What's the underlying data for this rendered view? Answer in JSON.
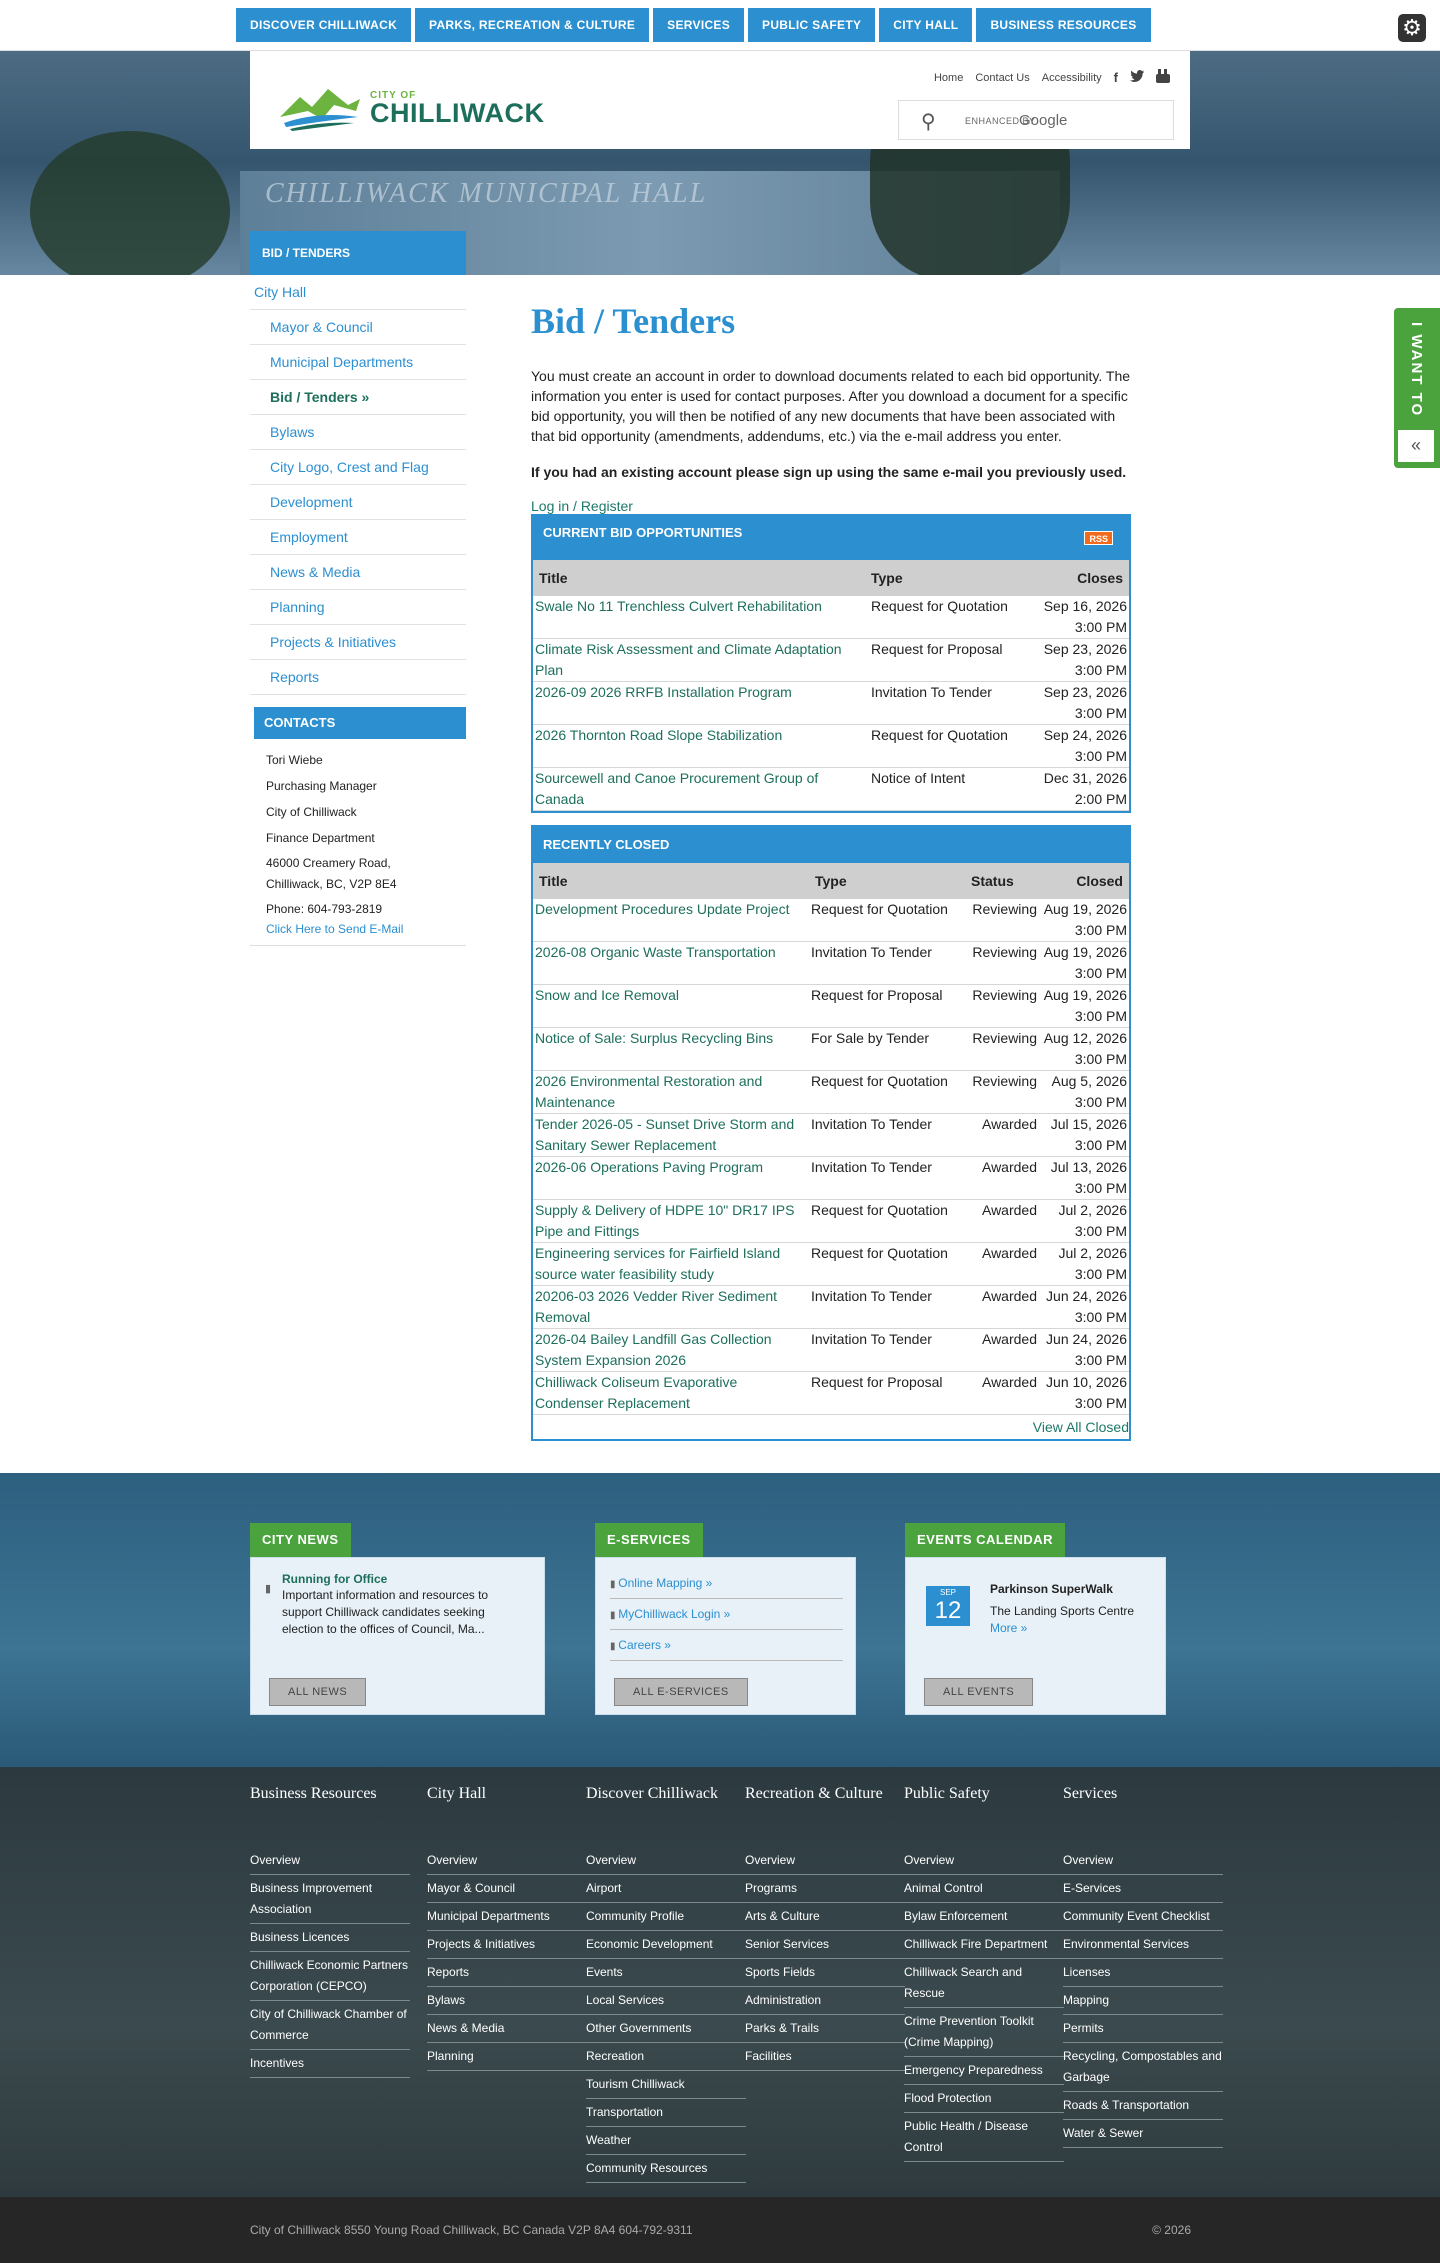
{
  "topnav": [
    "DISCOVER CHILLIWACK",
    "PARKS, RECREATION & CULTURE",
    "SERVICES",
    "PUBLIC SAFETY",
    "CITY HALL",
    "BUSINESS RESOURCES"
  ],
  "hero": {
    "building_text": "CHILLIWACK MUNICIPAL HALL"
  },
  "logo": {
    "small": "CITY OF",
    "big": "CHILLIWACK"
  },
  "utility": {
    "home": "Home",
    "contact": "Contact Us",
    "access": "Accessibility"
  },
  "search": {
    "enhanced": "ENHANCED BY",
    "brand": "Google"
  },
  "iwant": {
    "label": "I WANT TO",
    "chevron": "«"
  },
  "sidebar": {
    "header": "BID / TENDERS",
    "top": "City Hall",
    "items": [
      "Mayor & Council",
      "Municipal Departments",
      "Bid / Tenders »",
      "Bylaws",
      "City Logo, Crest and Flag",
      "Development",
      "Employment",
      "News & Media",
      "Planning",
      "Projects & Initiatives",
      "Reports"
    ]
  },
  "contacts": {
    "header": "CONTACTS",
    "name": "Tori Wiebe",
    "role": "Purchasing Manager",
    "org": "City of Chilliwack",
    "dept": "Finance Department",
    "addr1": "46000 Creamery Road,",
    "addr2": "Chilliwack, BC, V2P 8E4",
    "phone": "Phone: 604-793-2819",
    "email": "Click Here to Send E-Mail"
  },
  "content": {
    "title": "Bid / Tenders",
    "intro": "You must create an account in order to download documents related to each bid opportunity.  The information you enter is used for contact purposes.  After you download a document for a specific bid opportunity, you will then be notified of any new documents that have been associated with that bid opportunity (amendments, addendums, etc.) via the e-mail address you enter.",
    "note": "If you had an existing account please sign up using the same e-mail you previously used.",
    "login": "Log in / Register"
  },
  "current": {
    "header": "CURRENT BID OPPORTUNITIES",
    "rss": "RSS",
    "cols": {
      "title": "Title",
      "type": "Type",
      "closes": "Closes"
    },
    "rows": [
      {
        "title": "Swale No 11 Trenchless Culvert Rehabilitation",
        "type": "Request for Quotation",
        "date": "Sep 16, 2026",
        "time": "3:00 PM"
      },
      {
        "title": "Climate Risk Assessment and Climate Adaptation Plan",
        "type": "Request for Proposal",
        "date": "Sep 23, 2026",
        "time": "3:00 PM"
      },
      {
        "title": "2026-09 2026 RRFB Installation Program",
        "type": "Invitation To Tender",
        "date": "Sep 23, 2026",
        "time": "3:00 PM"
      },
      {
        "title": "2026 Thornton Road Slope Stabilization",
        "type": "Request for Quotation",
        "date": "Sep 24, 2026",
        "time": "3:00 PM"
      },
      {
        "title": "Sourcewell and Canoe Procurement Group of Canada",
        "type": "Notice of Intent",
        "date": "Dec 31, 2026",
        "time": "2:00 PM"
      }
    ]
  },
  "closed": {
    "header": "RECENTLY CLOSED",
    "cols": {
      "title": "Title",
      "type": "Type",
      "status": "Status",
      "closed": "Closed"
    },
    "view_all": "View All Closed",
    "rows": [
      {
        "title": "Development Procedures Update Project",
        "type": "Request for Quotation",
        "status": "Reviewing",
        "date": "Aug 19, 2026",
        "time": "3:00 PM"
      },
      {
        "title": "2026-08 Organic Waste Transportation",
        "type": "Invitation To Tender",
        "status": "Reviewing",
        "date": "Aug 19, 2026",
        "time": "3:00 PM"
      },
      {
        "title": "Snow and Ice Removal",
        "type": "Request for Proposal",
        "status": "Reviewing",
        "date": "Aug 19, 2026",
        "time": "3:00 PM"
      },
      {
        "title": "Notice of Sale: Surplus Recycling Bins",
        "type": "For Sale by Tender",
        "status": "Reviewing",
        "date": "Aug 12, 2026",
        "time": "3:00 PM"
      },
      {
        "title": "2026 Environmental Restoration and Maintenance",
        "type": "Request for Quotation",
        "status": "Reviewing",
        "date": "Aug 5, 2026",
        "time": "3:00 PM"
      },
      {
        "title": "Tender 2026-05 - Sunset Drive Storm and Sanitary Sewer Replacement",
        "type": "Invitation To Tender",
        "status": "Awarded",
        "date": "Jul 15, 2026",
        "time": "3:00 PM"
      },
      {
        "title": "2026-06 Operations Paving Program",
        "type": "Invitation To Tender",
        "status": "Awarded",
        "date": "Jul 13, 2026",
        "time": "3:00 PM"
      },
      {
        "title": "Supply & Delivery of HDPE 10\" DR17 IPS Pipe and Fittings",
        "type": "Request for Quotation",
        "status": "Awarded",
        "date": "Jul 2, 2026",
        "time": "3:00 PM"
      },
      {
        "title": "Engineering services for Fairfield Island source water feasibility study",
        "type": "Request for Quotation",
        "status": "Awarded",
        "date": "Jul 2, 2026",
        "time": "3:00 PM"
      },
      {
        "title": "20206-03 2026 Vedder River Sediment Removal",
        "type": "Invitation To Tender",
        "status": "Awarded",
        "date": "Jun 24, 2026",
        "time": "3:00 PM"
      },
      {
        "title": "2026-04 Bailey Landfill Gas Collection System Expansion 2026",
        "type": "Invitation To Tender",
        "status": "Awarded",
        "date": "Jun 24, 2026",
        "time": "3:00 PM"
      },
      {
        "title": "Chilliwack Coliseum Evaporative Condenser Replacement",
        "type": "Request for Proposal",
        "status": "Awarded",
        "date": "Jun 10, 2026",
        "time": "3:00 PM"
      }
    ]
  },
  "widgets": {
    "news": {
      "tab": "CITY NEWS",
      "headline": "Running for Office",
      "text": "Important information and resources to support Chilliwack candidates seeking election to the offices of Council, Ma...",
      "button": "ALL NEWS"
    },
    "eservices": {
      "tab": "E-SERVICES",
      "items": [
        "Online Mapping »",
        "MyChilliwack Login »",
        "Careers »"
      ],
      "button": "ALL E-SERVICES"
    },
    "events": {
      "tab": "EVENTS CALENDAR",
      "month": "SEP",
      "day": "12",
      "title": "Parkinson SuperWalk",
      "venue": "The Landing Sports Centre",
      "more": "More »",
      "button": "ALL EVENTS"
    }
  },
  "footer_cols": [
    {
      "title": "Business Resources",
      "links": [
        "Overview",
        "Business Improvement Association",
        "Business Licences",
        "Chilliwack Economic Partners Corporation (CEPCO)",
        "City of Chilliwack Chamber of Commerce",
        "Incentives"
      ]
    },
    {
      "title": "City Hall",
      "links": [
        "Overview",
        "Mayor & Council",
        "Municipal Departments",
        "Projects & Initiatives",
        "Reports",
        "Bylaws",
        "News & Media",
        "Planning"
      ]
    },
    {
      "title": "Discover Chilliwack",
      "links": [
        "Overview",
        "Airport",
        "Community Profile",
        "Economic Development",
        "Events",
        "Local Services",
        "Other Governments",
        "Recreation",
        "Tourism Chilliwack",
        "Transportation",
        "Weather",
        "Community Resources"
      ]
    },
    {
      "title": "Recreation & Culture",
      "links": [
        "Overview",
        "Programs",
        "Arts & Culture",
        "Senior Services",
        "Sports Fields",
        "Administration",
        "Parks & Trails",
        "Facilities"
      ]
    },
    {
      "title": "Public Safety",
      "links": [
        "Overview",
        "Animal Control",
        "Bylaw Enforcement",
        "Chilliwack Fire Department",
        "Chilliwack Search and Rescue",
        "Crime Prevention Toolkit (Crime Mapping)",
        "Emergency Preparedness",
        "Flood Protection",
        "Public Health / Disease Control"
      ]
    },
    {
      "title": "Services",
      "links": [
        "Overview",
        "E-Services",
        "Community Event Checklist",
        "Environmental Services",
        "Licenses",
        "Mapping",
        "Permits",
        "Recycling, Compostables and Garbage",
        "Roads & Transportation",
        "Water & Sewer"
      ]
    }
  ],
  "bottom": {
    "address": "City of Chilliwack 8550 Young Road Chilliwack, BC Canada V2P 8A4  604-792-9311",
    "copyright": "© 2026"
  }
}
